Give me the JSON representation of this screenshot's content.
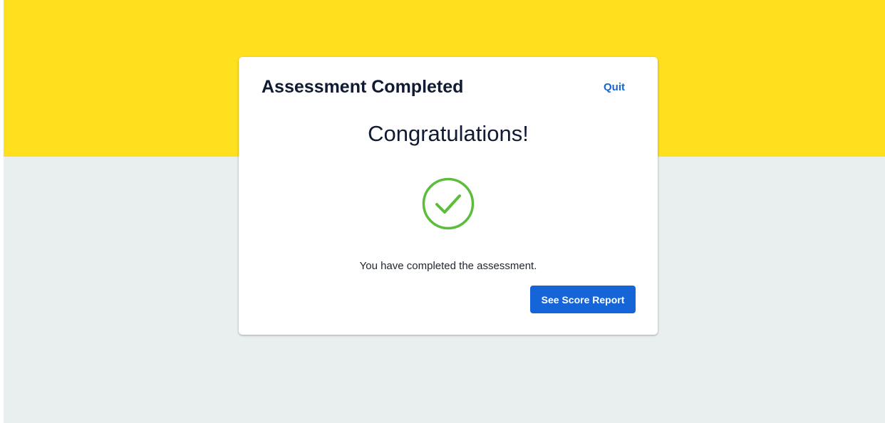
{
  "card": {
    "title": "Assessment Completed",
    "quit_label": "Quit",
    "headline": "Congratulations!",
    "icon": "check-circle-icon",
    "message": "You have completed the assessment.",
    "score_report_label": "See Score Report"
  },
  "colors": {
    "banner": "#ffe01e",
    "background": "#e9eeee",
    "accent": "#1565d8",
    "success": "#5cbd3c",
    "text": "#101a33"
  }
}
